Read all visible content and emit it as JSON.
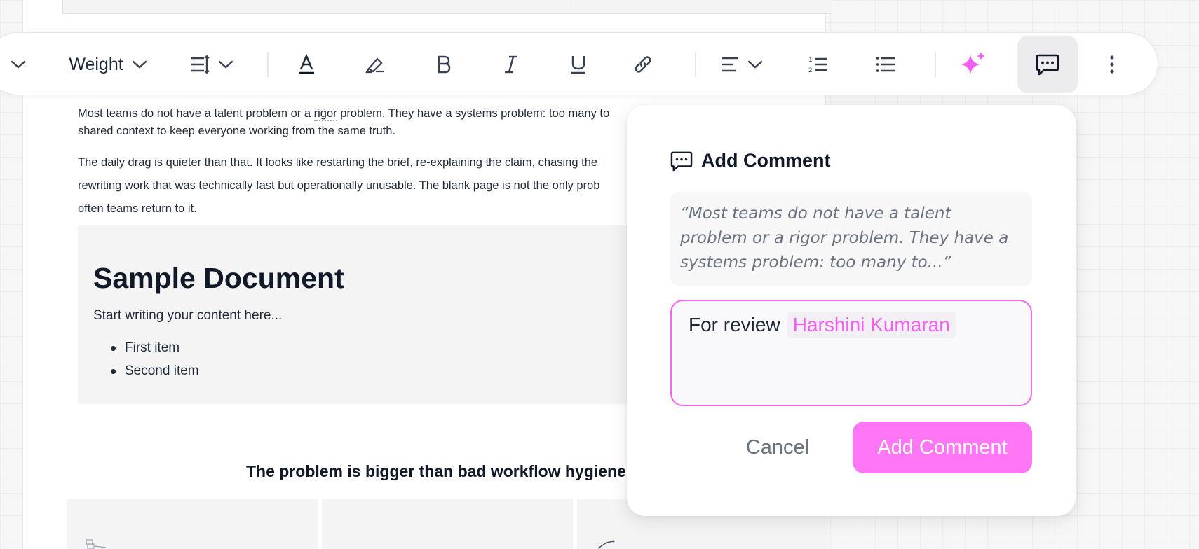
{
  "document": {
    "para1_line1_pre": "Most teams do not have a talent problem or a ",
    "para1_line1_mid": "rigor",
    "para1_line1_post": " problem. They have a systems problem: too many to",
    "para1_line2": "shared context to keep everyone working from the same truth.",
    "para2_line1": "The daily drag is quieter than that. It looks like restarting the brief, re-explaining the claim, chasing the",
    "para2_line2": "rewriting work that was technically fast but operationally unusable. The blank page is not the only prob",
    "para2_line3": "often teams return to it.",
    "callout": {
      "title": "Sample Document",
      "subtitle": "Start writing your content here...",
      "items": [
        "First item",
        "Second item"
      ]
    },
    "section_heading": "The problem is bigger than bad workflow hygiene"
  },
  "toolbar": {
    "weight_label": "Weight",
    "icons": [
      "chevron-down-icon",
      "line-spacing-icon",
      "text-color-icon",
      "highlighter-icon",
      "bold-icon",
      "italic-icon",
      "underline-icon",
      "link-icon",
      "align-left-icon",
      "numbered-list-icon",
      "bullet-list-icon",
      "ai-sparkle-icon",
      "comment-icon",
      "more-icon"
    ],
    "accent": "#f25ff2"
  },
  "comment_popover": {
    "title": "Add Comment",
    "quote": "“Most teams do not have a talent problem or a rigor problem. They have a systems problem: too many to...”",
    "input_text": "For review",
    "mention": "Harshini Kumaran",
    "cancel_label": "Cancel",
    "submit_label": "Add Comment",
    "accent": "#ff77f5"
  }
}
